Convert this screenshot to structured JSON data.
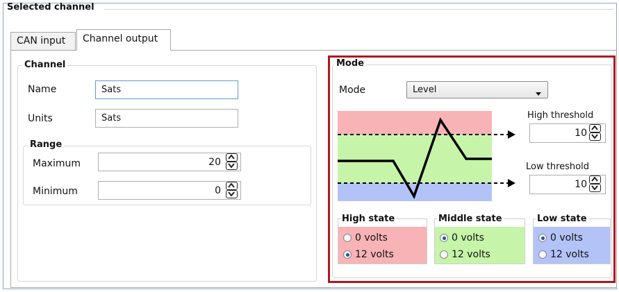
{
  "group_title": "Selected channel",
  "tabs": [
    {
      "label": "CAN input",
      "selected": false
    },
    {
      "label": "Channel output",
      "selected": true
    }
  ],
  "channel": {
    "legend": "Channel",
    "name_label": "Name",
    "name_value": "Sats",
    "units_label": "Units",
    "units_value": "Sats",
    "range": {
      "legend": "Range",
      "maximum_label": "Maximum",
      "maximum_value": "20",
      "minimum_label": "Minimum",
      "minimum_value": "0"
    }
  },
  "mode": {
    "legend": "Mode",
    "mode_label": "Mode",
    "mode_selected": "Level",
    "high_threshold_label": "High threshold",
    "high_threshold_value": "10",
    "low_threshold_label": "Low threshold",
    "low_threshold_value": "10",
    "states": [
      {
        "title": "High state",
        "options": [
          "0 volts",
          "12 volts"
        ],
        "selected": 1,
        "color": "#f7b3b6"
      },
      {
        "title": "Middle state",
        "options": [
          "0 volts",
          "12 volts"
        ],
        "selected": 0,
        "color": "#c6f5a9"
      },
      {
        "title": "Low state",
        "options": [
          "0 volts",
          "12 volts"
        ],
        "selected": 0,
        "color": "#b3c3f7"
      }
    ]
  },
  "colors": {
    "high_zone": "#f7b3b6",
    "middle_zone": "#c6f5a9",
    "low_zone": "#b3c3f7",
    "highlight_border": "#b0161e"
  },
  "icons": {
    "spinner": "up-down-arrows-icon",
    "dropdown": "chevron-down-icon",
    "threshold_arrow": "arrow-right-icon"
  }
}
